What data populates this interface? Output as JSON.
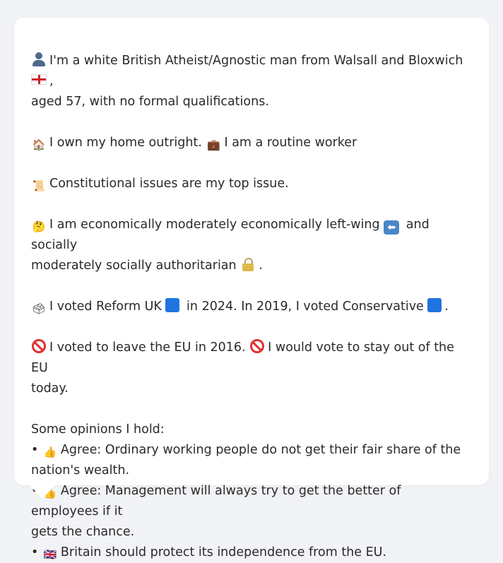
{
  "bio": {
    "line1_a": "I'm a white British Atheist/Agnostic man from Walsall and Bloxwich",
    "line1_b": ",",
    "line1_c": "aged 57, with no formal qualifications.",
    "home_a": "I own my home outright.",
    "home_b": "I am a routine worker",
    "issue": "Constitutional issues are my top issue.",
    "econ_a": "I am economically moderately economically left-wing",
    "econ_b": "and socially",
    "econ_c": "moderately socially authoritarian",
    "econ_d": ".",
    "vote_a": "I voted Reform UK",
    "vote_b": "in 2024. In 2019, I voted Conservative",
    "vote_c": ".",
    "eu_a": "I voted to leave the EU in 2016.",
    "eu_b": "I would vote to stay out of the EU",
    "eu_c": "today."
  },
  "opinions": {
    "heading": "Some opinions I hold:",
    "bullet": "•",
    "items": [
      {
        "prefix": "Agree: Ordinary working people do not get their fair share of the",
        "cont": "nation's wealth.",
        "icon": "thumbs-up-icon"
      },
      {
        "prefix": "Agree: Management will always try to get the better of employees if it",
        "cont": "gets the chance.",
        "icon": "thumbs-up-icon"
      },
      {
        "prefix": "Britain should protect its independence from the EU.",
        "cont": "",
        "icon": "uk-flag-icon"
      }
    ]
  },
  "colors": {
    "reform_uk": "#1f74e0",
    "conservative": "#1f74e0",
    "ban": "#e0312e"
  }
}
